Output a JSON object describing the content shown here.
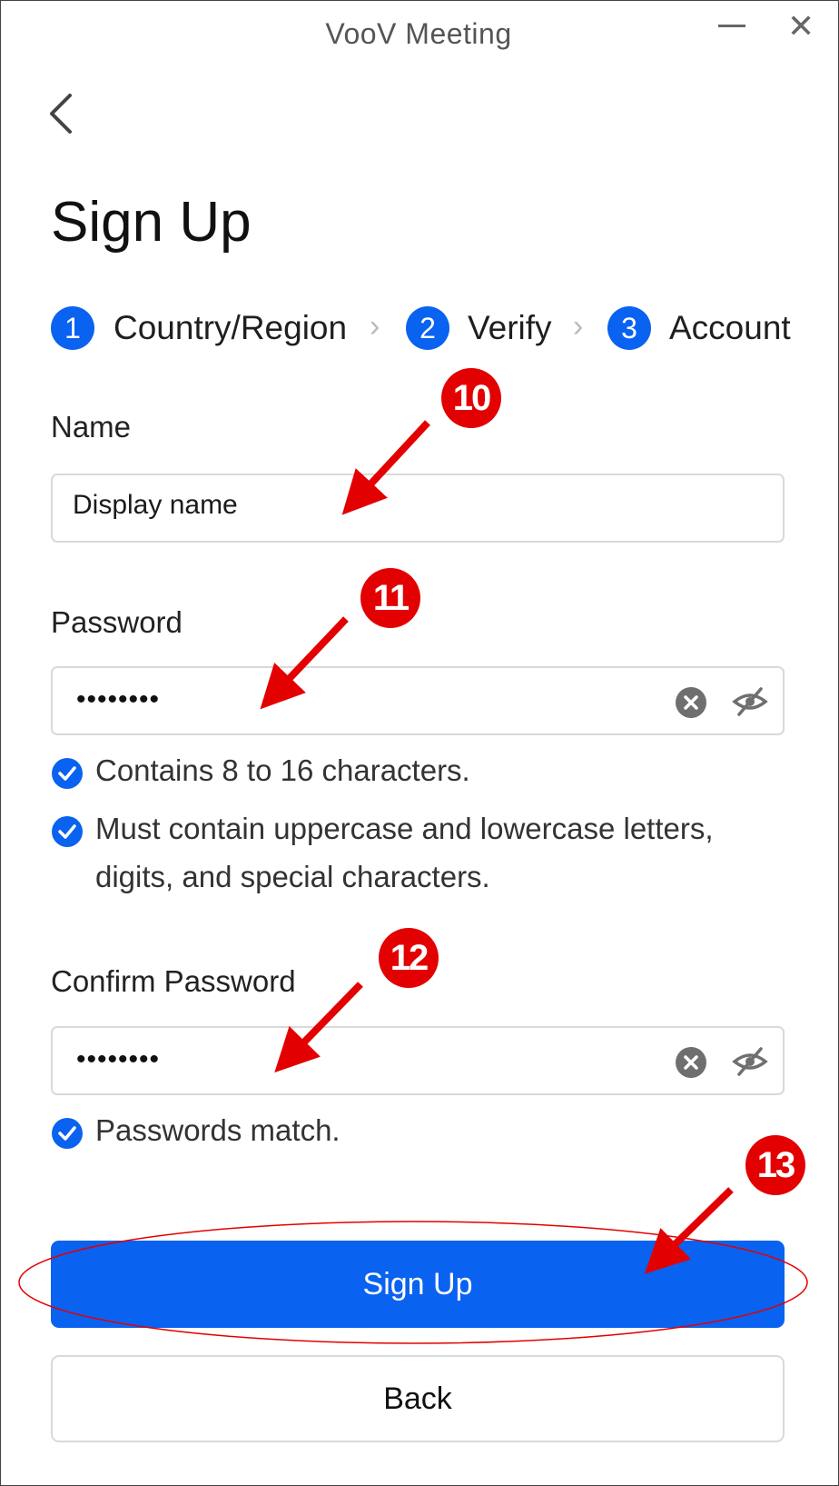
{
  "window": {
    "title": "VooV Meeting"
  },
  "page": {
    "heading": "Sign Up"
  },
  "steps": [
    {
      "number": "1",
      "label": "Country/Region"
    },
    {
      "number": "2",
      "label": "Verify"
    },
    {
      "number": "3",
      "label": "Account"
    }
  ],
  "form": {
    "name_label": "Name",
    "name_value": "Display name",
    "password_label": "Password",
    "password_value": "••••••••",
    "password_hints": [
      "Contains 8 to 16 characters.",
      "Must contain uppercase and lowercase letters, digits, and special characters."
    ],
    "confirm_label": "Confirm Password",
    "confirm_value": "••••••••",
    "confirm_hint": "Passwords match."
  },
  "buttons": {
    "signup": "Sign Up",
    "back": "Back"
  },
  "annotations": [
    "10",
    "11",
    "12",
    "13"
  ],
  "colors": {
    "accent": "#0a62f0",
    "annotation": "#e30000"
  },
  "icons": [
    "back-chevron-icon",
    "minimize-icon",
    "close-icon",
    "chevron-right-icon",
    "clear-icon",
    "eye-off-icon",
    "check-circle-icon"
  ]
}
